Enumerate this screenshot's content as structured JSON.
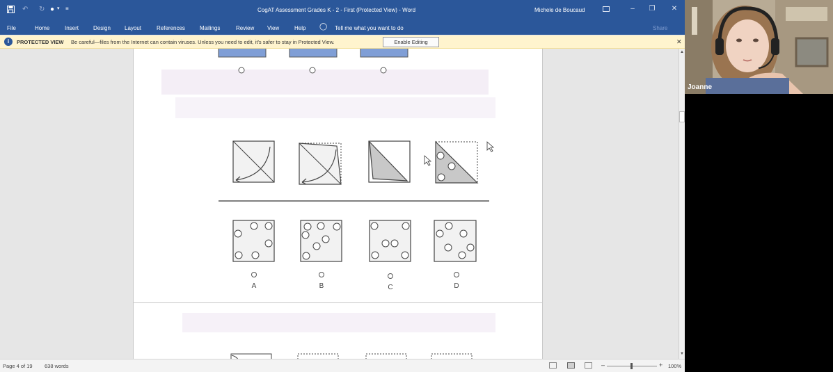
{
  "titlebar": {
    "document_title": "CogAT Assessment Grades K - 2 - First  (Protected View)  -  Word",
    "user": "Michele de Boucaud"
  },
  "ribbon": {
    "tabs": [
      "File",
      "Home",
      "Insert",
      "Design",
      "Layout",
      "References",
      "Mailings",
      "Review",
      "View",
      "Help"
    ],
    "tell_me": "Tell me what you want to do",
    "share": "Share"
  },
  "protected_view": {
    "label": "PROTECTED VIEW",
    "message": "Be careful—files from the Internet can contain viruses. Unless you need to edit, it's safer to stay in Protected View.",
    "enable_button": "Enable Editing"
  },
  "question": {
    "answer_options": [
      "A",
      "B",
      "C",
      "D"
    ]
  },
  "statusbar": {
    "page_info": "Page 4 of 19",
    "word_count": "638 words",
    "zoom": "100%"
  },
  "video": {
    "participant": "Joanne"
  },
  "colors": {
    "word_blue": "#2b579a",
    "message_bar": "#fff4ce",
    "shaded_fill": "#c8c8c8"
  }
}
